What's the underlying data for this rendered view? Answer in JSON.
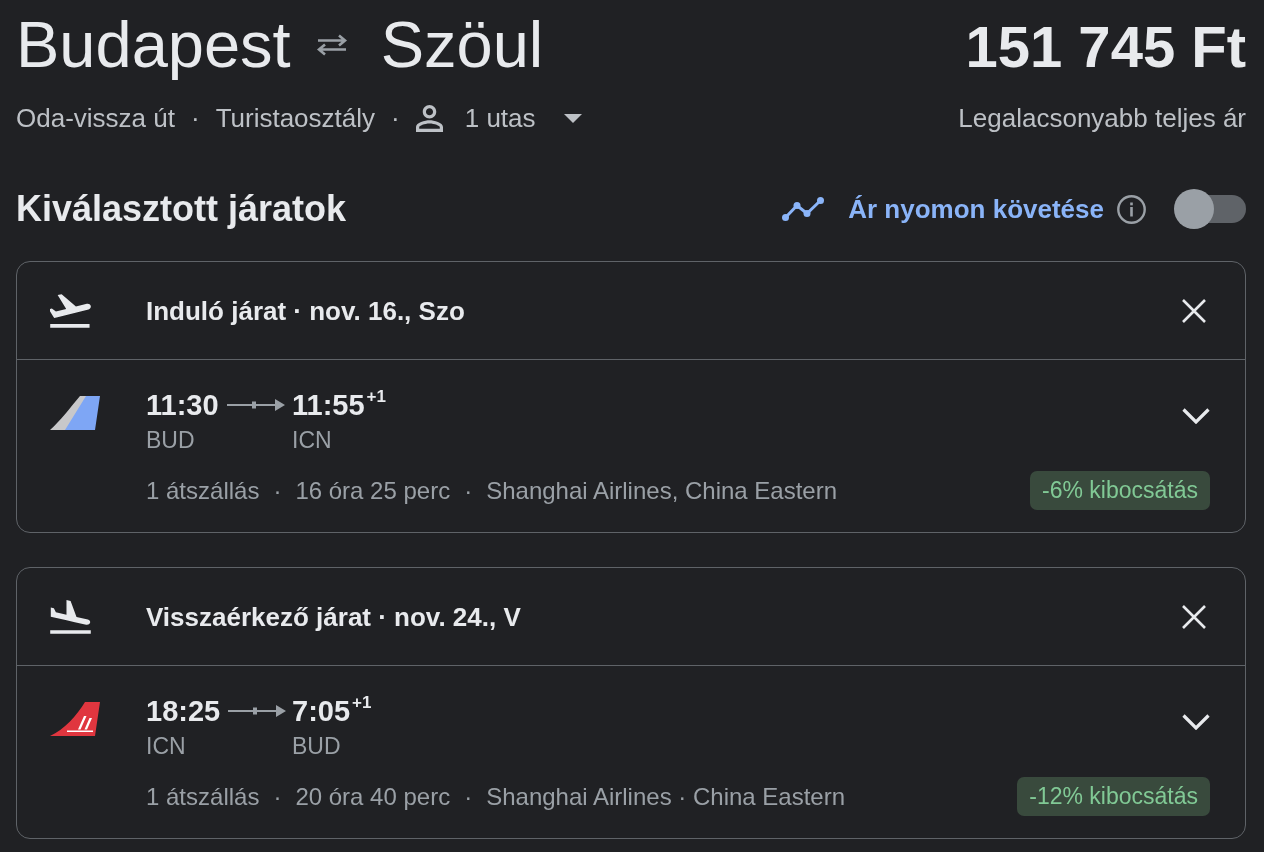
{
  "route": {
    "origin": "Budapest",
    "destination": "Szöul"
  },
  "price": "151 745 Ft",
  "trip_options": [
    {
      "kind": "trip_type",
      "text": "Oda-vissza út"
    },
    {
      "kind": "separator",
      "text": "·"
    },
    {
      "kind": "cabin_class",
      "text": "Turistaosztály"
    },
    {
      "kind": "separator",
      "text": "·"
    },
    {
      "kind": "passengers",
      "text": "1 utas"
    }
  ],
  "price_note": "Legalacsonyabb teljes ár",
  "section_title": "Kiválasztott járatok",
  "price_tracking": {
    "label": "Ár nyomon követése",
    "on": false
  },
  "flights": [
    {
      "kind": "departing",
      "title": "Induló járat · nov. 16., Szo",
      "logo": {
        "kind": "multiple"
      },
      "departure": {
        "time": "11:30",
        "airport": "BUD"
      },
      "arrival": {
        "time": "11:55",
        "day_offset": "+1",
        "airport": "ICN"
      },
      "details": [
        {
          "kind": "stops",
          "text": "1 átszállás"
        },
        {
          "kind": "separator",
          "text": "·"
        },
        {
          "kind": "duration",
          "text": "16 óra 25 perc"
        },
        {
          "kind": "separator",
          "text": "·"
        },
        {
          "kind": "airlines",
          "text": "Shanghai Airlines, China Eastern"
        }
      ],
      "emissions": "-6% kibocsátás",
      "expanded": false
    },
    {
      "kind": "returning",
      "title": "Visszaérkező járat · nov. 24., V",
      "logo": {
        "kind": "single"
      },
      "departure": {
        "time": "18:25",
        "airport": "ICN"
      },
      "arrival": {
        "time": "7:05",
        "day_offset": "+1",
        "airport": "BUD"
      },
      "details": [
        {
          "kind": "stops",
          "text": "1 átszállás"
        },
        {
          "kind": "separator",
          "text": "·"
        },
        {
          "kind": "duration",
          "text": "20 óra 40 perc"
        },
        {
          "kind": "separator",
          "text": "·"
        },
        {
          "kind": "airlines",
          "text": "Shanghai Airlines · China Eastern"
        }
      ],
      "emissions": "-12% kibocsátás",
      "expanded": false
    }
  ]
}
